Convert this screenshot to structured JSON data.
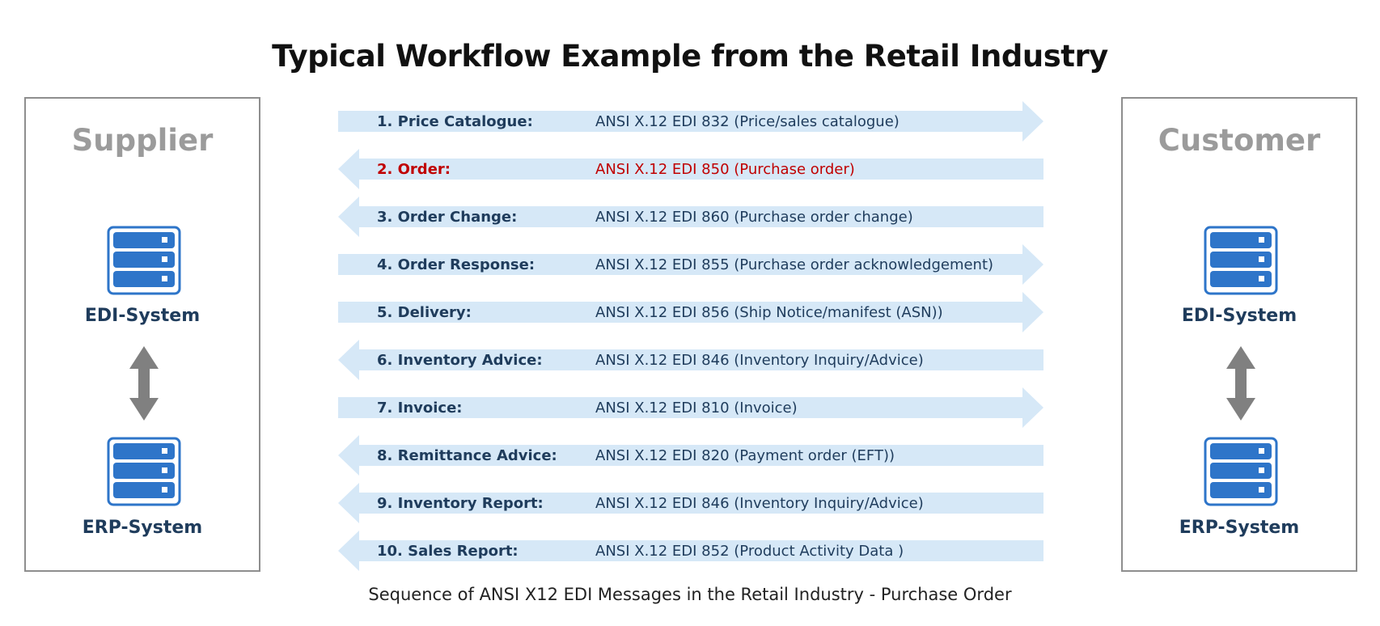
{
  "title": "Typical Workflow Example from the Retail Industry",
  "caption": "Sequence of ANSI X12 EDI Messages in the Retail Industry - Purchase Order",
  "colors": {
    "arrow_fill": "#d6e8f7",
    "text_dark": "#1f3c5c",
    "highlight": "#c00000",
    "box_border": "#8e8e8e",
    "party_title": "#9b9b9b",
    "server_blue": "#2e75c9",
    "double_arrow": "#808080"
  },
  "supplier": {
    "name": "Supplier",
    "edi_label": "EDI-System",
    "erp_label": "ERP-System",
    "icons": [
      "server-icon",
      "double-arrow-icon",
      "server-icon"
    ]
  },
  "customer": {
    "name": "Customer",
    "edi_label": "EDI-System",
    "erp_label": "ERP-System",
    "icons": [
      "server-icon",
      "double-arrow-icon",
      "server-icon"
    ]
  },
  "messages": [
    {
      "label": "1. Price Catalogue:",
      "code": "ANSI X.12 EDI 832 (Price/sales catalogue)",
      "direction": "right",
      "highlight": false
    },
    {
      "label": "2. Order:",
      "code": "ANSI X.12 EDI 850 (Purchase order)",
      "direction": "left",
      "highlight": true
    },
    {
      "label": "3. Order Change:",
      "code": "ANSI X.12 EDI 860 (Purchase order change)",
      "direction": "left",
      "highlight": false
    },
    {
      "label": "4. Order Response:",
      "code": "ANSI X.12 EDI 855 (Purchase order acknowledgement)",
      "direction": "right",
      "highlight": false
    },
    {
      "label": "5. Delivery:",
      "code": "ANSI X.12 EDI 856 (Ship Notice/manifest (ASN))",
      "direction": "right",
      "highlight": false
    },
    {
      "label": "6. Inventory Advice:",
      "code": "ANSI X.12 EDI 846 (Inventory Inquiry/Advice)",
      "direction": "left",
      "highlight": false
    },
    {
      "label": "7. Invoice:",
      "code": "ANSI X.12 EDI 810 (Invoice)",
      "direction": "right",
      "highlight": false
    },
    {
      "label": "8. Remittance Advice:",
      "code": "ANSI X.12 EDI 820 (Payment order (EFT))",
      "direction": "left",
      "highlight": false
    },
    {
      "label": "9. Inventory Report:",
      "code": "ANSI X.12 EDI 846 (Inventory Inquiry/Advice)",
      "direction": "left",
      "highlight": false
    },
    {
      "label": "10. Sales Report:",
      "code": "ANSI X.12 EDI 852 (Product Activity Data )",
      "direction": "left",
      "highlight": false
    }
  ]
}
